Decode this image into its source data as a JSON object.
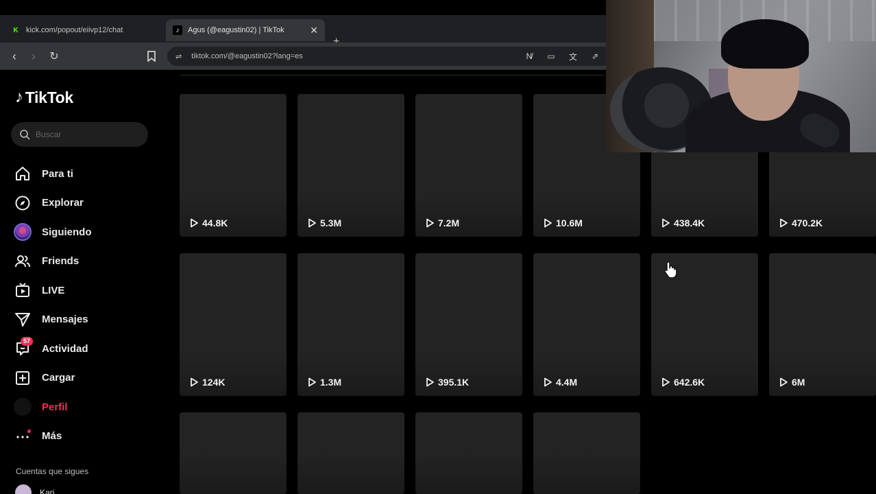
{
  "browser": {
    "tabs": [
      {
        "title": "kick.com/popout/eiivp12/chat",
        "favicon": "kick-icon"
      },
      {
        "title": "Agus (@eagustin02) | TikTok",
        "favicon": "tiktok-icon",
        "active": true
      }
    ],
    "url": "tiktok.com/@eagustin02?lang=es"
  },
  "sidebar": {
    "logo": "TikTok",
    "search_placeholder": "Buscar",
    "items": [
      {
        "label": "Para ti",
        "icon": "home-icon"
      },
      {
        "label": "Explorar",
        "icon": "compass-icon"
      },
      {
        "label": "Siguiendo",
        "icon": "following-avatar-icon"
      },
      {
        "label": "Friends",
        "icon": "friends-icon"
      },
      {
        "label": "LIVE",
        "icon": "live-tv-icon"
      },
      {
        "label": "Mensajes",
        "icon": "send-icon"
      },
      {
        "label": "Actividad",
        "icon": "activity-icon",
        "badge": "57"
      },
      {
        "label": "Cargar",
        "icon": "upload-plus-icon"
      },
      {
        "label": "Perfil",
        "icon": "profile-avatar-icon",
        "active": true
      },
      {
        "label": "Más",
        "icon": "more-icon"
      }
    ],
    "following_title": "Cuentas que sigues",
    "following": [
      {
        "name": "Kari"
      }
    ]
  },
  "videos": [
    {
      "views": "44.8K"
    },
    {
      "views": "5.3M"
    },
    {
      "views": "7.2M"
    },
    {
      "views": "10.6M"
    },
    {
      "views": "438.4K"
    },
    {
      "views": "470.2K"
    },
    {
      "views": "124K"
    },
    {
      "views": "1.3M"
    },
    {
      "views": "395.1K"
    },
    {
      "views": "4.4M"
    },
    {
      "views": "642.6K"
    },
    {
      "views": "6M"
    },
    {
      "views": ""
    },
    {
      "views": ""
    },
    {
      "views": ""
    },
    {
      "views": ""
    }
  ],
  "colors": {
    "accent": "#fe2c55",
    "kick_green": "#53fc18",
    "card": "#232323"
  }
}
